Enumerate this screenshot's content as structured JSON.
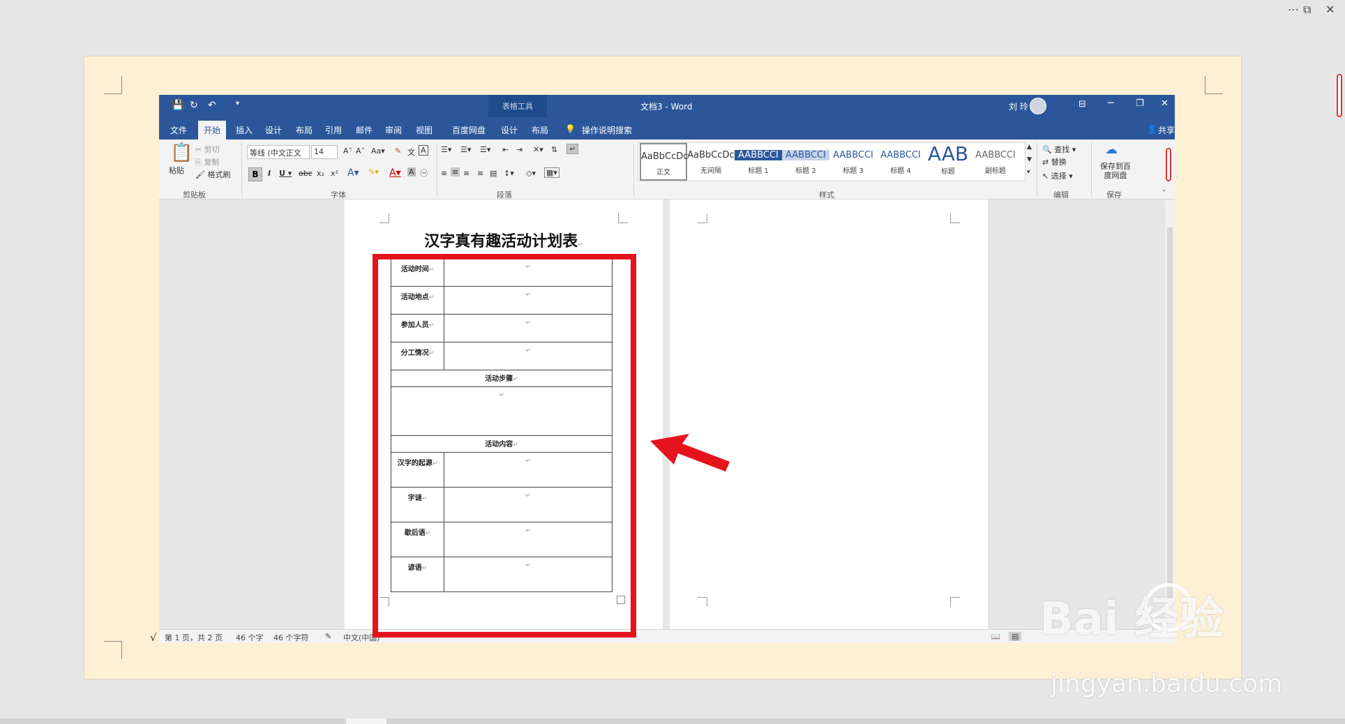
{
  "outer_window": {
    "more_icon": "⋯",
    "restore_icon": "⧉",
    "close_icon": "✕"
  },
  "checkmark": "√",
  "word": {
    "title": "文档3 - Word",
    "context_tab_group": "表格工具",
    "user_name": "刘 玲",
    "share_label": "共享",
    "tell_me": "操作说明搜索",
    "tabs": [
      "文件",
      "开始",
      "插入",
      "设计",
      "布局",
      "引用",
      "邮件",
      "审阅",
      "视图",
      "百度网盘",
      "设计",
      "布局"
    ],
    "ribbon": {
      "clipboard": {
        "paste": "粘贴",
        "cut": "剪切",
        "copy": "复制",
        "format_painter": "格式刷",
        "group": "剪贴板"
      },
      "font": {
        "font_name": "等线 (中文正文",
        "font_size": "14",
        "group": "字体"
      },
      "paragraph": {
        "group": "段落"
      },
      "styles": {
        "group": "样式",
        "items": [
          {
            "preview": "AaBbCcDc",
            "name": "正文"
          },
          {
            "preview": "AaBbCcDc",
            "name": "无间隔"
          },
          {
            "preview": "AABBCCI",
            "name": "标题 1"
          },
          {
            "preview": "AABBCCI",
            "name": "标题 2"
          },
          {
            "preview": "AABBCCI",
            "name": "标题 3"
          },
          {
            "preview": "AABBCCI",
            "name": "标题 4"
          },
          {
            "preview": "AAB",
            "name": "标题"
          },
          {
            "preview": "AABBCCI",
            "name": "副标题"
          }
        ]
      },
      "editing": {
        "find": "查找",
        "replace": "替换",
        "select": "选择",
        "group": "编辑"
      },
      "save": {
        "label": "保存到百度网盘",
        "group": "保存"
      }
    },
    "document": {
      "title": "汉字真有趣活动计划表",
      "rows": [
        {
          "label": "活动时间"
        },
        {
          "label": "活动地点"
        },
        {
          "label": "参加人员"
        },
        {
          "label": "分工情况"
        }
      ],
      "section_steps": "活动步骤",
      "section_content": "活动内容",
      "content_rows": [
        {
          "label": "汉字的起源"
        },
        {
          "label": "字谜"
        },
        {
          "label": "歇后语"
        },
        {
          "label": "谚语"
        }
      ],
      "para_mark": "↵"
    },
    "status": {
      "page": "第 1 页，共 2 页",
      "words": "46 个字",
      "chars": "46 个字符",
      "language": "中文(中国)"
    }
  },
  "watermark": {
    "main": "Bai  经验",
    "sub": "jingyan.baidu.com"
  }
}
